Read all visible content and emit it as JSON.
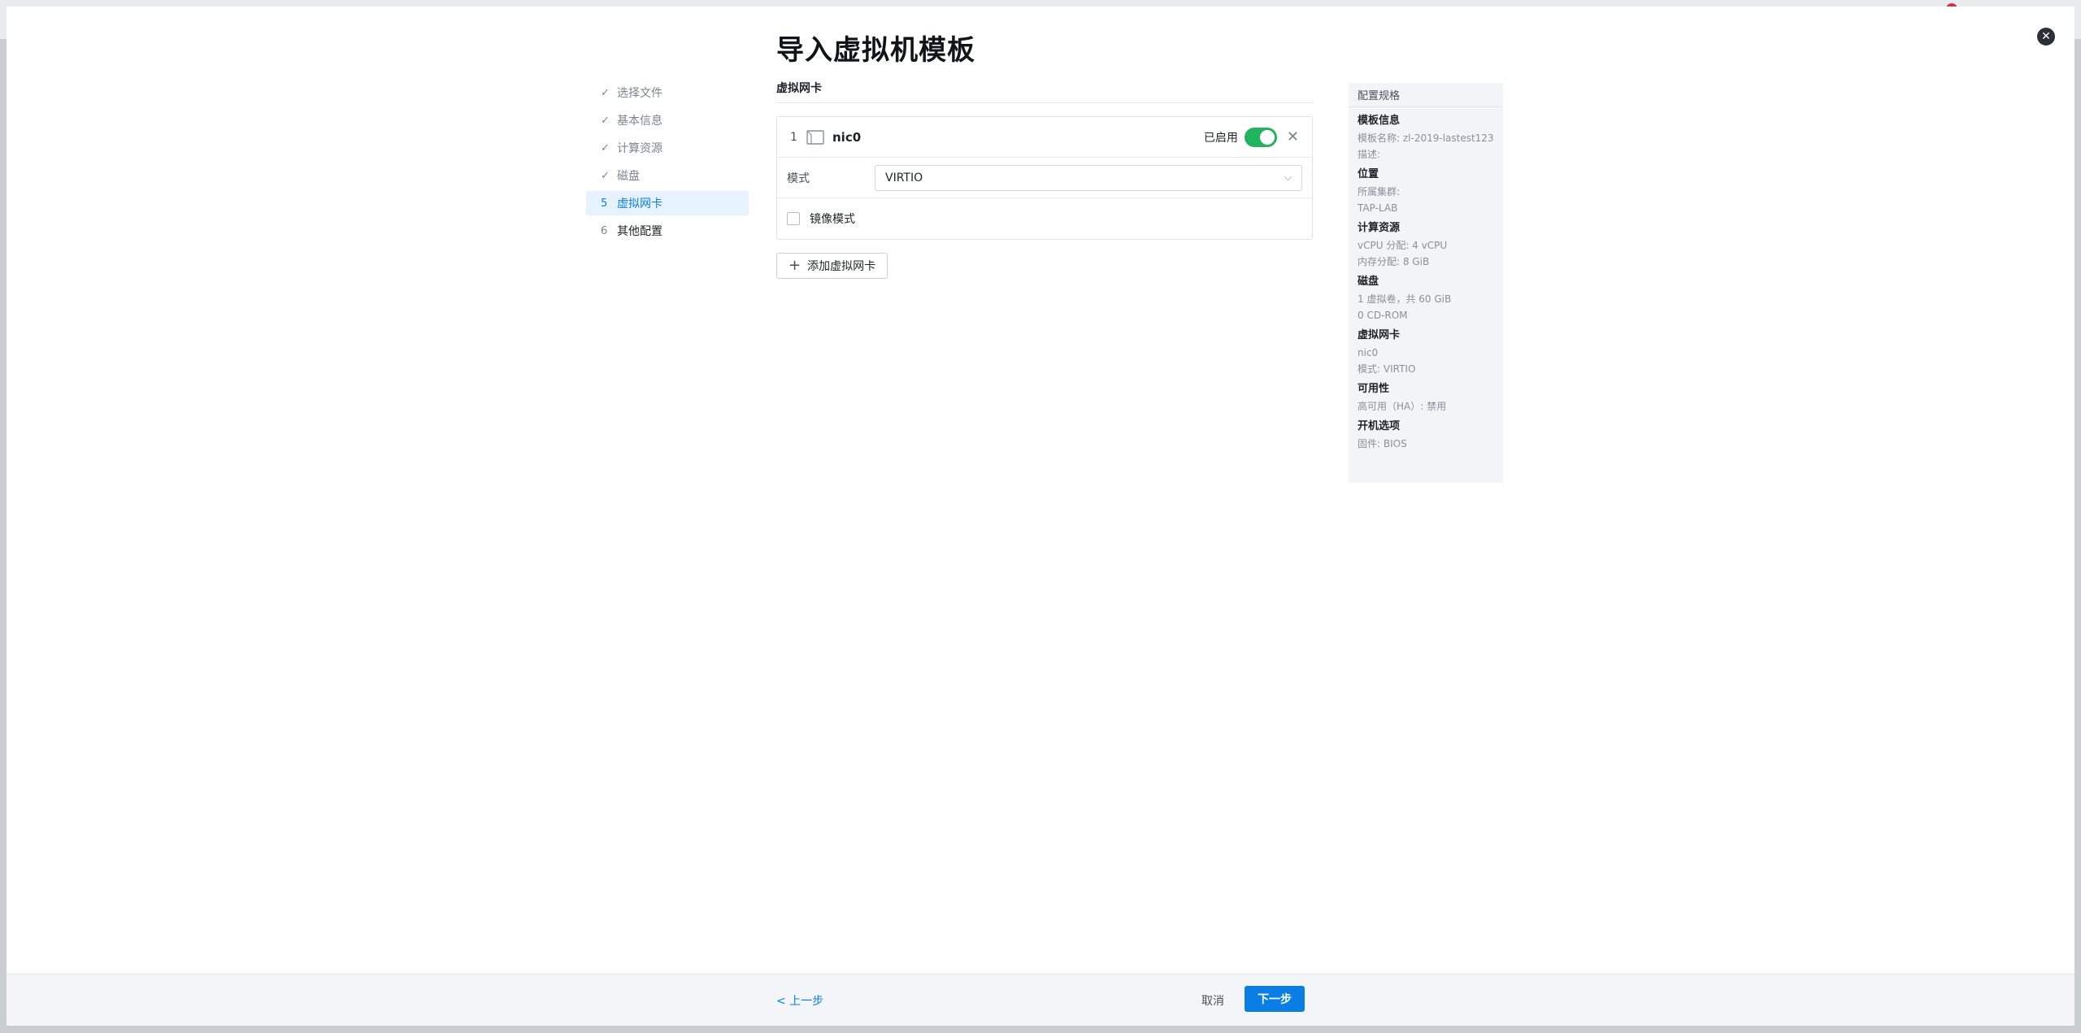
{
  "modal": {
    "title": "导入虚拟机模板",
    "close_glyph": "✕"
  },
  "steps": [
    {
      "mark": "✓",
      "label": "选择文件",
      "state": "done"
    },
    {
      "mark": "✓",
      "label": "基本信息",
      "state": "done"
    },
    {
      "mark": "✓",
      "label": "计算资源",
      "state": "done"
    },
    {
      "mark": "✓",
      "label": "磁盘",
      "state": "done"
    },
    {
      "mark": "5",
      "label": "虚拟网卡",
      "state": "active"
    },
    {
      "mark": "6",
      "label": "其他配置",
      "state": "pending"
    }
  ],
  "nic_section": {
    "title": "虚拟网卡",
    "nic": {
      "index": "1",
      "name": "nic0",
      "enabled_label": "已启用",
      "enabled": true,
      "mode_label": "模式",
      "mode_value": "VIRTIO",
      "mirror_label": "镜像模式",
      "mirror_checked": false
    },
    "add_button_label": "添加虚拟网卡"
  },
  "summary": {
    "title": "配置规格",
    "groups": [
      {
        "title": "模板信息",
        "lines": [
          "模板名称: zl-2019-lastest123",
          "描述:"
        ]
      },
      {
        "title": "位置",
        "lines": [
          "所属集群:",
          "TAP-LAB"
        ]
      },
      {
        "title": "计算资源",
        "lines": [
          "vCPU 分配: 4 vCPU",
          "内存分配: 8 GiB"
        ]
      },
      {
        "title": "磁盘",
        "lines": [
          "1 虚拟卷，共 60 GiB",
          "0 CD-ROM"
        ]
      },
      {
        "title": "虚拟网卡",
        "lines": [
          "nic0",
          "模式: VIRTIO"
        ]
      },
      {
        "title": "可用性",
        "lines": [
          "高可用（HA）: 禁用"
        ]
      },
      {
        "title": "开机选项",
        "lines": [
          "固件: BIOS"
        ]
      }
    ]
  },
  "footer": {
    "prev_label": "< 上一步",
    "cancel_label": "取消",
    "next_label": "下一步"
  },
  "colors": {
    "accent": "#0b7ee6",
    "toggle_on": "#21b35e",
    "notification": "#d4353b"
  },
  "icons": {
    "close": "close-icon",
    "nic": "network-card-icon",
    "remove": "close-icon",
    "add": "plus-icon",
    "select": "chevron-down-icon"
  }
}
